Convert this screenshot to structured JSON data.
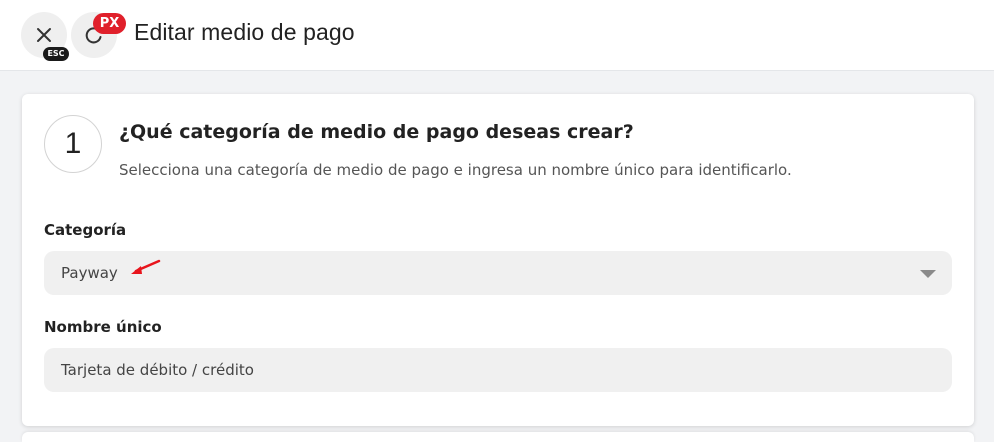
{
  "header": {
    "title": "Editar medio de pago",
    "esc_badge": "ESC",
    "px_badge": "PX",
    "close_icon": "close-icon",
    "refresh_icon": "refresh-icon"
  },
  "step": {
    "number": "1",
    "title": "¿Qué categoría de medio de pago deseas crear?",
    "subtitle": "Selecciona una categoría de medio de pago e ingresa un nombre único para identificarlo."
  },
  "fields": {
    "category": {
      "label": "Categoría",
      "value": "Payway"
    },
    "unique_name": {
      "label": "Nombre único",
      "value": "Tarjeta de débito / crédito"
    }
  },
  "colors": {
    "annotation_arrow": "#e8141c",
    "badge_red": "#e0202b"
  }
}
